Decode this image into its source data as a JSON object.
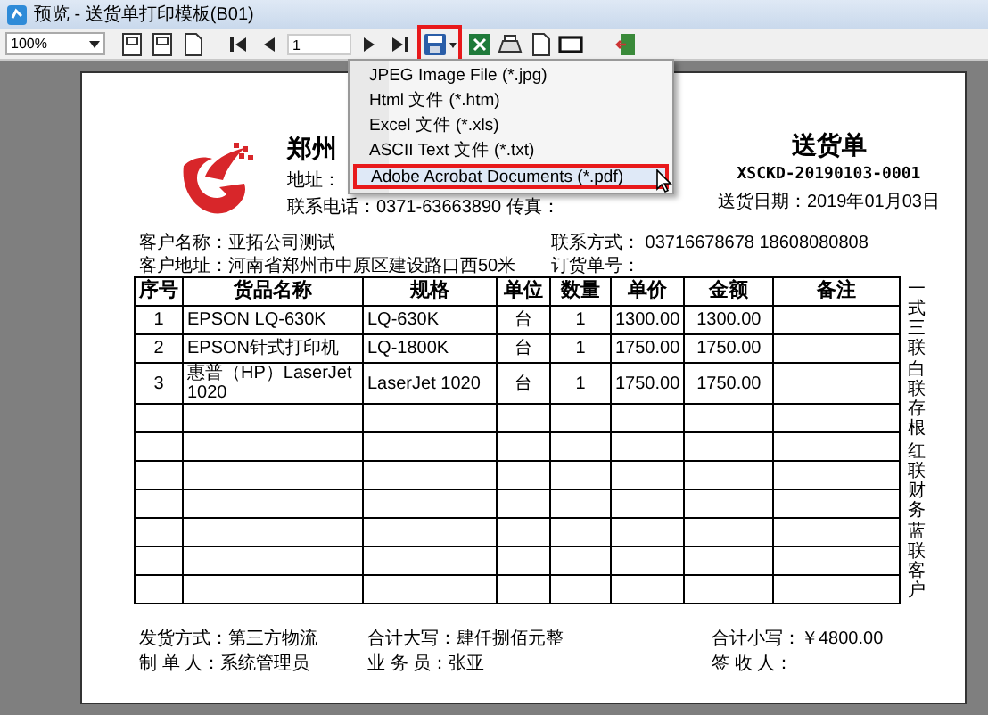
{
  "window": {
    "title": "预览 - 送货单打印模板(B01)"
  },
  "toolbar": {
    "zoom": "100%",
    "page": "1",
    "save_highlighted": true
  },
  "export_menu": {
    "items": [
      {
        "label": "JPEG Image File (*.jpg)",
        "highlighted": false
      },
      {
        "label": "Html 文件 (*.htm)",
        "highlighted": false
      },
      {
        "label": "Excel 文件 (*.xls)",
        "highlighted": false
      },
      {
        "label": "ASCII Text 文件 (*.txt)",
        "highlighted": false
      },
      {
        "label": "Adobe Acrobat Documents (*.pdf)",
        "highlighted": true
      }
    ]
  },
  "document": {
    "company": {
      "name": "郑州",
      "address": "地址：",
      "phone": "联系电话：0371-63663890  传真："
    },
    "title": "送货单",
    "number": "XSCKD-20190103-0001",
    "date": "送货日期：2019年01月03日",
    "customer": [
      [
        "客户名称：亚拓公司测试",
        "联系方式： 03716678678 18608080808"
      ],
      [
        "客户地址：河南省郑州市中原区建设路口西50米",
        "订货单号："
      ]
    ],
    "table": {
      "columns": [
        "序号",
        "货品名称",
        "规格",
        "单位",
        "数量",
        "单价",
        "金额",
        "备注"
      ],
      "rows": [
        [
          "1",
          "EPSON LQ-630K",
          "LQ-630K",
          "台",
          "1",
          "1300.00",
          "1300.00"
        ],
        [
          "2",
          "EPSON针式打印机",
          "LQ-1800K",
          "台",
          "1",
          "1750.00",
          "1750.00"
        ],
        [
          "3",
          "惠普（HP）LaserJet 1020",
          "LaserJet 1020",
          "台",
          "1",
          "1750.00",
          "1750.00"
        ]
      ]
    },
    "copies": [
      "一式三联",
      "白联存根",
      "红联财务",
      "蓝联客户"
    ],
    "footer": [
      [
        "发货方式：第三方物流",
        "合计大写：肆仟捌佰元整",
        "合计小写：￥4800.00"
      ],
      [
        "制 单 人：系统管理员",
        "业 务 员：张亚",
        "签 收 人："
      ]
    ]
  }
}
